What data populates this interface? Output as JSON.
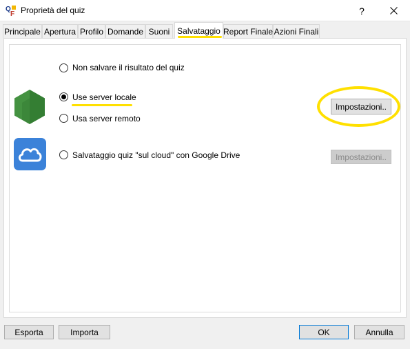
{
  "window": {
    "title": "Proprietà del quiz",
    "help_label": "?",
    "icon": "quiz-app-icon"
  },
  "tabs": [
    {
      "label": "Principale"
    },
    {
      "label": "Apertura"
    },
    {
      "label": "Profilo"
    },
    {
      "label": "Domande"
    },
    {
      "label": "Suoni"
    },
    {
      "label": "Salvataggio",
      "active": true
    },
    {
      "label": "Report Finale"
    },
    {
      "label": "Azioni Finali"
    }
  ],
  "options": {
    "no_save": {
      "label": "Non salvare il risultato del quiz",
      "checked": false
    },
    "local_server": {
      "label": "Use server locale",
      "checked": true
    },
    "remote_server": {
      "label": "Usa server remoto",
      "checked": false
    },
    "cloud": {
      "label": "Salvataggio quiz \"sul cloud\" con Google Drive",
      "checked": false
    }
  },
  "buttons": {
    "server_settings": {
      "label": "Impostazioni..",
      "enabled": true
    },
    "cloud_settings": {
      "label": "Impostazioni..",
      "enabled": false
    },
    "export": "Esporta",
    "import": "Importa",
    "ok": "OK",
    "cancel": "Annulla"
  },
  "icons": {
    "server": "nodejs-hexagon-icon",
    "cloud": "cloud-icon"
  },
  "colors": {
    "highlight": "#ffe000",
    "node_green": "#3c873a",
    "cloud_blue": "#3b82d9"
  }
}
